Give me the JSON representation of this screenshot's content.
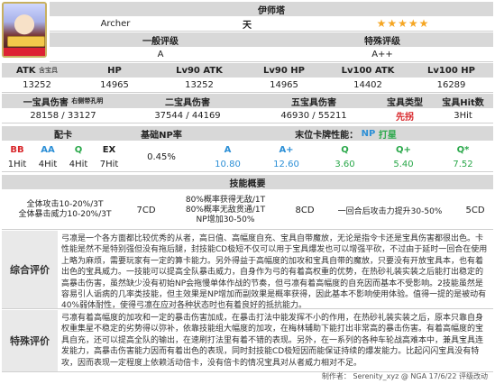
{
  "servant": {
    "name": "伊师塔",
    "class_label": "Archer",
    "attribute": "天",
    "stars": "★★★★★",
    "portrait_icon": "servant-portrait-icon"
  },
  "ratings": {
    "general_header": "一般评级",
    "special_header": "特殊评级",
    "general": "A",
    "special": "A++"
  },
  "stats": {
    "headers": [
      "ATK",
      "含宝具",
      "HP",
      "Lv90 ATK",
      "Lv90 HP",
      "Lv100 ATK",
      "Lv100 HP"
    ],
    "values": [
      "13252",
      "14965",
      "13252",
      "14965",
      "14402",
      "16289"
    ]
  },
  "np": {
    "h1": "一宝具伤害",
    "h1_sub": "右侧带孔明",
    "h2": "二宝具伤害",
    "h3": "五宝具伤害",
    "h4": "宝具类型",
    "h5": "宝具Hit数",
    "v1": "28158 / 33127",
    "v2": "37544 / 44169",
    "v3": "46930 / 55211",
    "v4": "先拐",
    "v5": "3Hit"
  },
  "cards": {
    "h_cards": "配卡",
    "h_base": "基础NP率",
    "h_last": "末位卡牌性能：",
    "h_last2": "NP",
    "h_last3": "打星",
    "labels": [
      "BB",
      "AA",
      "Q",
      "EX"
    ],
    "hits": [
      "1Hit",
      "4Hit",
      "4Hit",
      "7Hit"
    ],
    "np_rate": "0.45%",
    "perf_labels": [
      "A",
      "A+",
      "Q",
      "Q+",
      "Q*"
    ],
    "perf_values": [
      "10.80",
      "12.60",
      "3.60",
      "5.40",
      "7.52"
    ]
  },
  "skills": {
    "header": "技能概要",
    "s1_text": "全体攻击10-20%/3T\n全体暴击威力10-20%/3T",
    "s1_cd": "7CD",
    "s2_text": "80%概率获得无敌/1T\n80%概率无敌贯通/1T\nNP增加30-50%",
    "s2_cd": "8CD",
    "s3_text": "一回合后攻击力提升30-50%",
    "s3_cd": "5CD"
  },
  "review": {
    "overall_label": "综合评价",
    "overall_text": "弓凛是一个各方面都比较优秀的从者，高日值、高幅度自充、宝具自带魔放，无论是指令卡还是宝具伤害都很出色。卡性能是然不是特别强但没有拖后腿，封技能CD极短不仅可以用于宝具爆发也可以增强平砍，不过由于延时一回合在使用上略为麻烦，需要玩家有一定的算卡能力。另外得益于高幅度的加攻和宝具自带的魔放，只要没有开放宝具本，也有着出色的宝具威力。一技能可以提高全队暴击威力，自身作为弓的有着高权重的优势，在热砂礼装实装之后能打出稳定的高暴击伤害，虽然缺少没有初始NP会拖慢单体作战的节奏，但弓凛有着高幅度的自充因而基本不受影响。2技能虽然是容易引人诟病的几率类技能，但主效果是NP增加而副效果是概率获得，因此基本不影响使用体验。值得一提的是被动有40%弱体耐性，使得弓凛在应对各种状态时也有着良好的抵抗能力。",
    "special_label": "特殊评价",
    "special_text": "弓凛有着高幅度的加攻和一定的暴击伤害加成，在暴击打法中能发挥不小的作用，在热砂礼装实装之后，原本只靠自身权重集星不稳定的劣势得以弥补，依靠技能组大幅度的加攻，在梅林辅助下能打出非常高的暴击伤害。有着高幅度的宝具自充，还可以提高全队的输出，在速刷打法里有着不错的表现。另外，在一系列的各种车轮战高难本中，兼具宝具连发能力，高暴击伤害能力因而有着出色的表现，同时封技能CD极短因而能保证持续的爆发能力。比起闪闪宝具没有特攻，因而表现一定程度上依赖活动倍卡，没有倍卡的情况宝具对从者威力相对不足。"
  },
  "footer": {
    "author": "制作者：",
    "credit": "Serenity_xyz @ NGA 17/6/22 评级改动"
  }
}
